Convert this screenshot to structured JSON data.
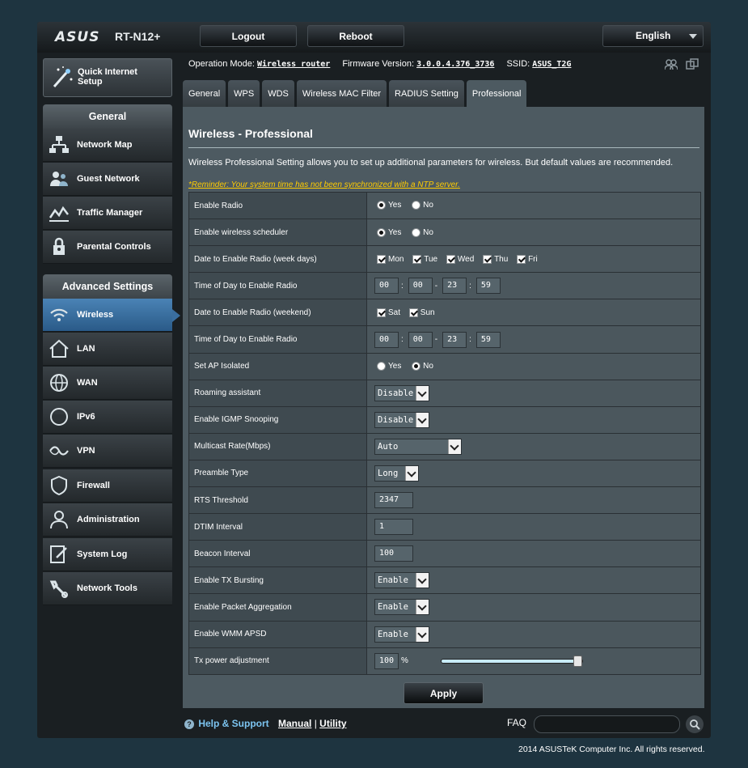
{
  "header": {
    "brand": "ASUS",
    "model": "RT-N12+",
    "logout_label": "Logout",
    "reboot_label": "Reboot",
    "language": "English"
  },
  "info": {
    "op_mode_label": "Operation Mode:",
    "op_mode_value": "Wireless router",
    "fw_label": "Firmware Version:",
    "fw_value": "3.0.0.4.376_3736",
    "ssid_label": "SSID:",
    "ssid_value": "ASUS_T2G"
  },
  "sidebar": {
    "qis_label_1": "Quick Internet",
    "qis_label_2": "Setup",
    "general_header": "General",
    "general_items": [
      {
        "label": "Network Map",
        "icon": "network-map-icon"
      },
      {
        "label": "Guest Network",
        "icon": "guest-network-icon"
      },
      {
        "label": "Traffic Manager",
        "icon": "traffic-manager-icon"
      },
      {
        "label": "Parental Controls",
        "icon": "parental-controls-icon"
      }
    ],
    "advanced_header": "Advanced Settings",
    "advanced_items": [
      {
        "label": "Wireless",
        "icon": "wireless-icon",
        "active": true
      },
      {
        "label": "LAN",
        "icon": "lan-icon"
      },
      {
        "label": "WAN",
        "icon": "wan-icon"
      },
      {
        "label": "IPv6",
        "icon": "ipv6-icon"
      },
      {
        "label": "VPN",
        "icon": "vpn-icon"
      },
      {
        "label": "Firewall",
        "icon": "firewall-icon"
      },
      {
        "label": "Administration",
        "icon": "administration-icon"
      },
      {
        "label": "System Log",
        "icon": "system-log-icon"
      },
      {
        "label": "Network Tools",
        "icon": "network-tools-icon"
      }
    ]
  },
  "tabs": [
    "General",
    "WPS",
    "WDS",
    "Wireless MAC Filter",
    "RADIUS Setting",
    "Professional"
  ],
  "active_tab": "Professional",
  "page": {
    "title": "Wireless - Professional",
    "description": "Wireless Professional Setting allows you to set up additional parameters for wireless. But default values are recommended.",
    "reminder": "*Reminder: Your system time has not been synchronized with a NTP server."
  },
  "labels": {
    "yes": "Yes",
    "no": "No",
    "colon": ":",
    "dash": "-",
    "percent": "%"
  },
  "settings": {
    "enable_radio": {
      "label": "Enable Radio",
      "value": "Yes"
    },
    "enable_scheduler": {
      "label": "Enable wireless scheduler",
      "value": "Yes"
    },
    "weekdays": {
      "label": "Date to Enable Radio (week days)",
      "days": [
        "Mon",
        "Tue",
        "Wed",
        "Thu",
        "Fri"
      ]
    },
    "weekday_time": {
      "label": "Time of Day to Enable Radio",
      "h1": "00",
      "m1": "00",
      "h2": "23",
      "m2": "59"
    },
    "weekend": {
      "label": "Date to Enable Radio (weekend)",
      "days": [
        "Sat",
        "Sun"
      ]
    },
    "weekend_time": {
      "label": "Time of Day to Enable Radio",
      "h1": "00",
      "m1": "00",
      "h2": "23",
      "m2": "59"
    },
    "ap_isolated": {
      "label": "Set AP Isolated",
      "value": "No"
    },
    "roaming": {
      "label": "Roaming assistant",
      "value": "Disable"
    },
    "igmp": {
      "label": "Enable IGMP Snooping",
      "value": "Disable"
    },
    "multicast": {
      "label": "Multicast Rate(Mbps)",
      "value": "Auto"
    },
    "preamble": {
      "label": "Preamble Type",
      "value": "Long"
    },
    "rts": {
      "label": "RTS Threshold",
      "value": "2347"
    },
    "dtim": {
      "label": "DTIM Interval",
      "value": "1"
    },
    "beacon": {
      "label": "Beacon Interval",
      "value": "100"
    },
    "tx_bursting": {
      "label": "Enable TX Bursting",
      "value": "Enable"
    },
    "pkt_aggr": {
      "label": "Enable Packet Aggregation",
      "value": "Enable"
    },
    "wmm_apsd": {
      "label": "Enable WMM APSD",
      "value": "Enable"
    },
    "tx_power": {
      "label": "Tx power adjustment",
      "value": "100",
      "level": 1.0
    }
  },
  "apply_label": "Apply",
  "footer": {
    "help_icon": "?",
    "help_label": "Help & Support",
    "manual": "Manual",
    "divider": "|",
    "utility": "Utility",
    "faq": "FAQ",
    "copyright": "2014 ASUSTeK Computer Inc. All rights reserved."
  },
  "colors": {
    "accent_active": "#3a6e9f",
    "warning": "#ffcc00",
    "help_link": "#7cc4f0",
    "panel": "#4d5a61"
  }
}
